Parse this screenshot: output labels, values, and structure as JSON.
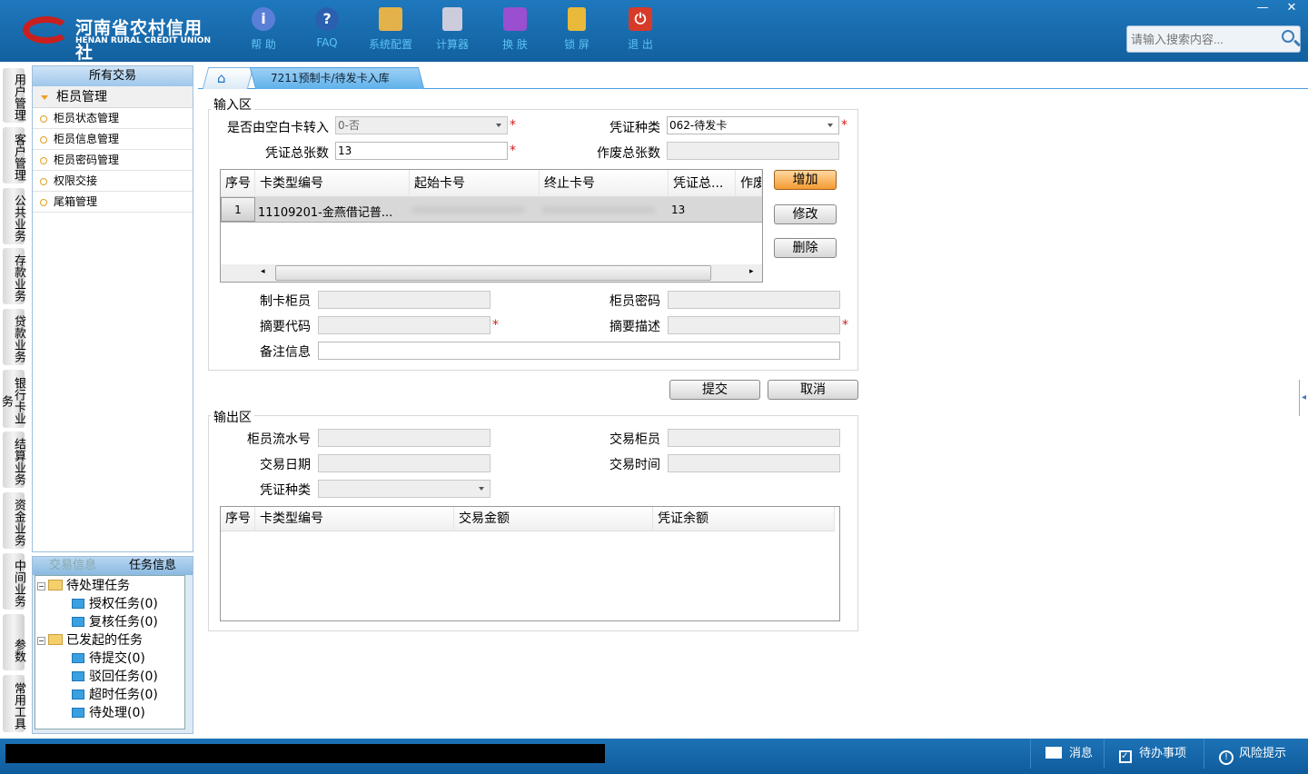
{
  "header": {
    "logo_cn": "河南省农村信用社",
    "logo_en": "HENAN RURAL CREDIT UNION",
    "tools": [
      {
        "label": "帮 助",
        "icon": "info-icon"
      },
      {
        "label": "FAQ",
        "icon": "question-icon"
      },
      {
        "label": "系统配置",
        "icon": "toolbox-icon"
      },
      {
        "label": "计算器",
        "icon": "calculator-icon"
      },
      {
        "label": "换 肤",
        "icon": "shirt-icon"
      },
      {
        "label": "锁 屏",
        "icon": "lock-icon"
      },
      {
        "label": "退 出",
        "icon": "power-icon"
      }
    ],
    "search_placeholder": "请输入搜索内容...",
    "minimize": "—",
    "close": "✕"
  },
  "vtabs": [
    "用户管理",
    "客户管理",
    "公共业务",
    "存款业务",
    "贷款业务",
    "银行卡业务",
    "结算业务",
    "资金业务",
    "中间业务",
    "参数",
    "常用工具"
  ],
  "sidebar": {
    "title": "所有交易",
    "group": "柜员管理",
    "items": [
      "柜员状态管理",
      "柜员信息管理",
      "柜员密码管理",
      "权限交接",
      "尾箱管理"
    ]
  },
  "task": {
    "tabs": [
      "交易信息",
      "任务信息"
    ],
    "pending": "待处理任务",
    "pending_items": [
      "授权任务(0)",
      "复核任务(0)"
    ],
    "started": "已发起的任务",
    "started_items": [
      "待提交(0)",
      "驳回任务(0)",
      "超时任务(0)",
      "待处理(0)"
    ]
  },
  "tabs": {
    "active": "7211预制卡/待发卡入库",
    "close": "×"
  },
  "input": {
    "legend": "输入区",
    "blank_label": "是否由空白卡转入",
    "blank_value": "0-否",
    "voucher_type_label": "凭证种类",
    "voucher_type_value": "062-待发卡",
    "total_label": "凭证总张数",
    "total_value": "13",
    "void_label": "作废总张数",
    "void_value": "",
    "columns": [
      "序号",
      "卡类型编号",
      "起始卡号",
      "终止卡号",
      "凭证总...",
      "作废"
    ],
    "rows": [
      {
        "no": "1",
        "card_type": "11109201-金燕借记普...",
        "start": "",
        "end": "",
        "total": "13"
      }
    ],
    "add": "增加",
    "edit": "修改",
    "delete": "删除",
    "maker_label": "制卡柜员",
    "pwd_label": "柜员密码",
    "abs_code_label": "摘要代码",
    "abs_desc_label": "摘要描述",
    "remark_label": "备注信息"
  },
  "actions": {
    "submit": "提交",
    "cancel": "取消"
  },
  "output": {
    "legend": "输出区",
    "serial_label": "柜员流水号",
    "teller_label": "交易柜员",
    "date_label": "交易日期",
    "time_label": "交易时间",
    "voucher_type_label": "凭证种类",
    "columns": [
      "序号",
      "卡类型编号",
      "交易金额",
      "凭证余额"
    ]
  },
  "status": {
    "message": "消息",
    "todo": "待办事项",
    "risk": "风险提示"
  }
}
